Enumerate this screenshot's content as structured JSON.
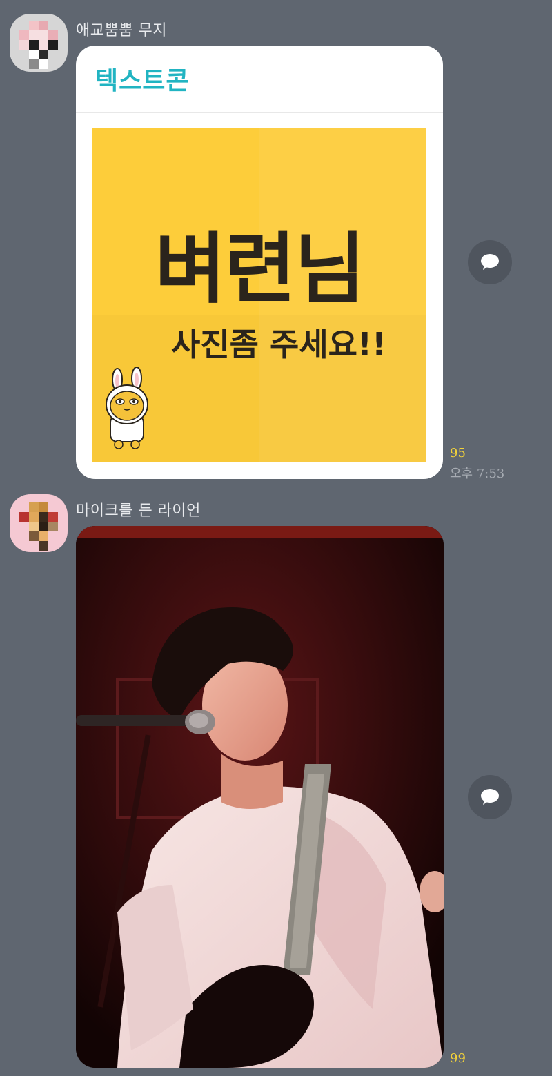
{
  "messages": [
    {
      "sender": "애교뿜뿜 무지",
      "card": {
        "header_label": "텍스트콘",
        "big_text": "벼련님",
        "sub_text": "사진좀 주세요!!"
      },
      "unread_count": "95",
      "time": "오후 7:53",
      "reply_icon": "speech-bubble-icon"
    },
    {
      "sender": "마이크를 든 라이언",
      "image": "concert-photo",
      "unread_count": "99",
      "reply_icon": "speech-bubble-icon"
    }
  ],
  "colors": {
    "background": "#5f6670",
    "card_accent": "#21b4c2",
    "emoticon_bg": "#fdcd3a",
    "unread": "#f2d23a"
  }
}
